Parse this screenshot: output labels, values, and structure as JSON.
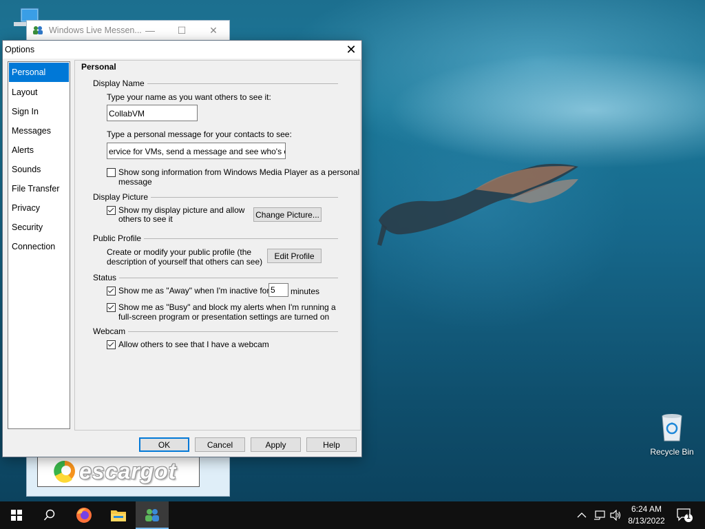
{
  "desktop": {
    "recycle_bin_label": "Recycle Bin"
  },
  "messenger_window": {
    "title": "Windows Live Messen...",
    "minimize_glyph": "—",
    "maximize_glyph": "☐",
    "close_glyph": "✕",
    "banner_text": "escargot"
  },
  "dialog": {
    "title": "Options",
    "close_glyph": "✕",
    "categories": [
      "Personal",
      "Layout",
      "Sign In",
      "Messages",
      "Alerts",
      "Sounds",
      "File Transfer",
      "Privacy",
      "Security",
      "Connection"
    ],
    "selected_category": "Personal",
    "panel_title": "Personal",
    "display_name": {
      "section": "Display Name",
      "name_prompt": "Type your name as you want others to see it:",
      "name_value": "CollabVM",
      "message_prompt": "Type a personal message for your contacts to see:",
      "message_value": "ervice for VMs, send a message and see who's online",
      "song_info_line1": "Show song information from Windows Media Player as a personal",
      "song_info_line2": "message",
      "song_info_checked": false
    },
    "display_picture": {
      "section": "Display Picture",
      "show_line1": "Show my display picture and allow",
      "show_line2": "others to see it",
      "show_checked": true,
      "change_button": "Change Picture..."
    },
    "public_profile": {
      "section": "Public Profile",
      "desc_line1": "Create or modify your public profile (the",
      "desc_line2": "description of yourself that others can see)",
      "edit_button": "Edit Profile"
    },
    "status": {
      "section": "Status",
      "away_label": "Show me as \"Away\" when I'm inactive for",
      "away_checked": true,
      "away_minutes": "5",
      "minutes_label": "minutes",
      "busy_line1": "Show me as \"Busy\" and block my alerts when I'm running a",
      "busy_line2": "full-screen program or presentation settings are turned on",
      "busy_checked": true
    },
    "webcam": {
      "section": "Webcam",
      "allow_label": "Allow others to see that I have a webcam",
      "allow_checked": true
    },
    "buttons": {
      "ok": "OK",
      "cancel": "Cancel",
      "apply": "Apply",
      "help": "Help"
    }
  },
  "taskbar": {
    "time": "6:24 AM",
    "date": "8/13/2022",
    "notification_count": "1",
    "icons": [
      "start-icon",
      "search-icon",
      "firefox-icon",
      "file-explorer-icon",
      "messenger-icon"
    ]
  }
}
